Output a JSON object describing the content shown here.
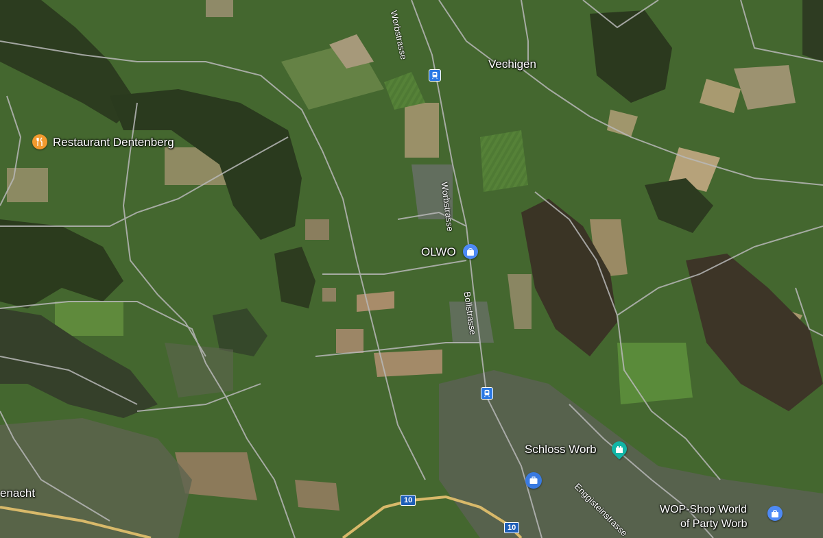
{
  "map": {
    "labels": {
      "vechigen": "Vechigen",
      "restaurant_dentenberg": "Restaurant Dentenberg",
      "olwo": "OLWO",
      "schloss_worb": "Schloss Worb",
      "wop_shop_line1": "WOP-Shop World",
      "wop_shop_line2": "of Party Worb",
      "enacht": "enacht"
    },
    "roads": {
      "worbstrasse_top": "Worbstrasse",
      "worbstrasse_mid": "Worbstrasse",
      "bollstrasse": "Bollstrasse",
      "enggisteinstrasse": "Enggisteinstrasse"
    },
    "shields": {
      "route_10_left": "10",
      "route_10_right": "10"
    },
    "icons": {
      "restaurant": "fork-knife-icon",
      "shopping": "shopping-bag-icon",
      "castle": "castle-icon",
      "briefcase": "briefcase-icon",
      "train": "train-icon"
    },
    "colors": {
      "restaurant_pin": "#f29a2e",
      "shop_pin": "#4e8af5",
      "castle_pin": "#12b5a6",
      "briefcase_pin": "#3a7ae0",
      "train_badge": "#2a78e4"
    }
  }
}
